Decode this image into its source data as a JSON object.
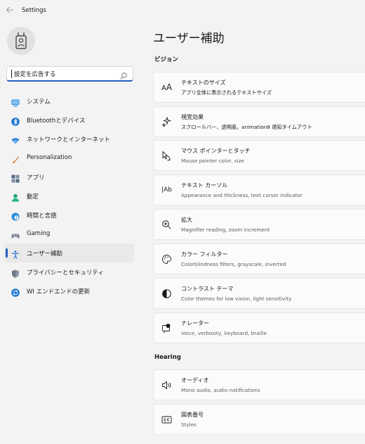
{
  "window": {
    "title": "Settings"
  },
  "search": {
    "value": "設定を広告する"
  },
  "nav": {
    "items": [
      {
        "label": "システム",
        "icon": "monitor-icon",
        "active": false
      },
      {
        "label": "Bluetoothとデバイス",
        "icon": "bluetooth-icon",
        "active": false
      },
      {
        "label": "ネットワークとインターネット",
        "icon": "wifi-icon",
        "active": false
      },
      {
        "label": "Personalization",
        "icon": "brush-icon",
        "active": false
      },
      {
        "label": "アプリ",
        "icon": "apps-icon",
        "active": false
      },
      {
        "label": "動定",
        "icon": "account-icon",
        "active": false
      },
      {
        "label": "時間と言語",
        "icon": "globe-clock-icon",
        "active": false
      },
      {
        "label": "Gaming",
        "icon": "gamepad-icon",
        "active": false
      },
      {
        "label": "ユーザー補助",
        "icon": "accessibility-icon",
        "active": true
      },
      {
        "label": "プライバシーとセキュリティ",
        "icon": "shield-icon",
        "active": false
      },
      {
        "label": "WI エンドエンドの更新",
        "icon": "update-icon",
        "active": false
      }
    ]
  },
  "main": {
    "title": "ユーザー補助",
    "sections": [
      {
        "label": "ビジョン",
        "cards": [
          {
            "title": "テキストのサイズ",
            "subtitle": "アプリ全体に表示されるテキストサイズ",
            "icon": "text-size-icon"
          },
          {
            "title": "視覚効果",
            "subtitle": "スクロールバー、透明度。animation8 通知タイムアウト",
            "icon": "sparkle-icon"
          },
          {
            "title": "マウス ポインターとタッチ",
            "subtitle": "Mouse pointer color, size",
            "icon": "mouse-pointer-icon"
          },
          {
            "title": "テキスト カーソル",
            "subtitle": "Appearance and thickness, text cursor indicator",
            "icon": "text-cursor-icon"
          },
          {
            "title": "拡大",
            "subtitle": "Magnifier reading, zoom increment",
            "icon": "magnifier-icon"
          },
          {
            "title": "カラー フィルター",
            "subtitle": "Colorblindness filters, grayscale, inverted",
            "icon": "palette-icon"
          },
          {
            "title": "コントラスト テーマ",
            "subtitle": "Color themes for low vision, light sensitivity",
            "icon": "contrast-icon"
          },
          {
            "title": "ナレーター",
            "subtitle": "Voice, verbosity, keyboard, braille",
            "icon": "narrator-icon"
          }
        ]
      },
      {
        "label": "Hearing",
        "cards": [
          {
            "title": "オーディオ",
            "subtitle": "Mono audio, audio notifications",
            "icon": "speaker-icon"
          },
          {
            "title": "図表番号",
            "subtitle": "Styles",
            "icon": "captions-icon"
          }
        ]
      }
    ]
  },
  "colors": {
    "accent": "#1f5fbf",
    "background": "#f3f3f3",
    "card": "#fbfbfb"
  }
}
